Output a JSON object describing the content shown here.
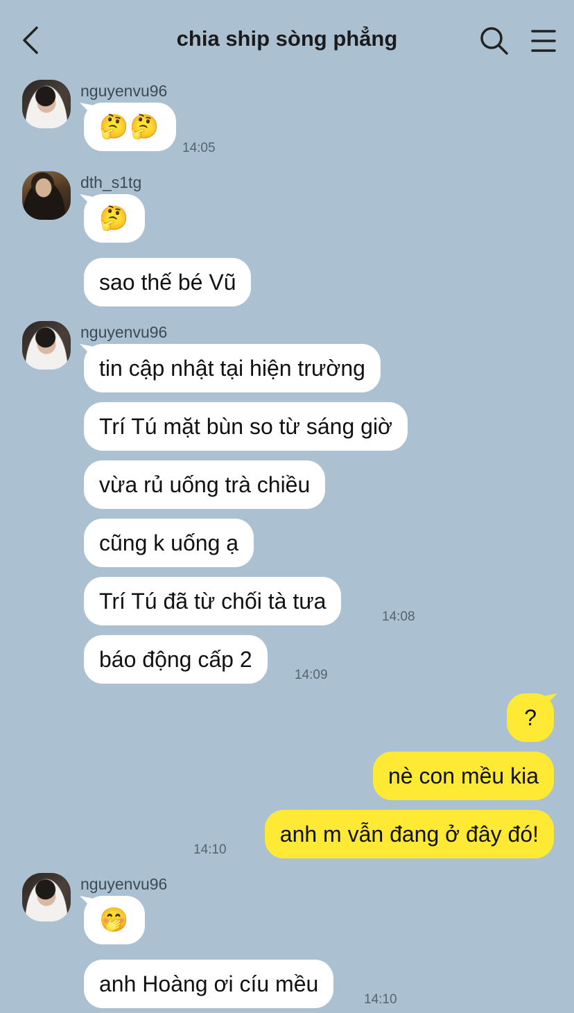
{
  "header": {
    "title": "chia ship sòng phẳng",
    "back_icon": "chevron-left-icon",
    "search_icon": "search-icon",
    "menu_icon": "hamburger-menu-icon"
  },
  "colors": {
    "background": "#abc1d1",
    "bubble_in": "#ffffff",
    "bubble_out": "#fee934"
  },
  "messages": [
    {
      "sender": "nguyenvu96",
      "text": "🤔🤔",
      "time": "14:05"
    },
    {
      "sender": "dth_s1tg",
      "text": "🤔"
    },
    {
      "sender": "dth_s1tg",
      "text": "sao thế bé Vũ"
    },
    {
      "sender": "nguyenvu96",
      "text": "tin cập nhật tại hiện trường"
    },
    {
      "sender": "nguyenvu96",
      "text": "Trí Tú mặt bùn so từ sáng giờ"
    },
    {
      "sender": "nguyenvu96",
      "text": "vừa rủ uống trà chiều"
    },
    {
      "sender": "nguyenvu96",
      "text": "cũng k uống ạ"
    },
    {
      "sender": "nguyenvu96",
      "text": "Trí Tú đã từ chối tà tưa",
      "time": "14:08"
    },
    {
      "sender": "nguyenvu96",
      "text": "báo động cấp 2",
      "time": "14:09"
    },
    {
      "sender": "me",
      "text": "?"
    },
    {
      "sender": "me",
      "text": "nè con mều kia"
    },
    {
      "sender": "me",
      "text": "anh m vẫn đang ở đây đó!",
      "time": "14:10"
    },
    {
      "sender": "nguyenvu96",
      "text": "🤭"
    },
    {
      "sender": "nguyenvu96",
      "text": "anh Hoàng ơi cíu mều",
      "time": "14:10"
    }
  ]
}
